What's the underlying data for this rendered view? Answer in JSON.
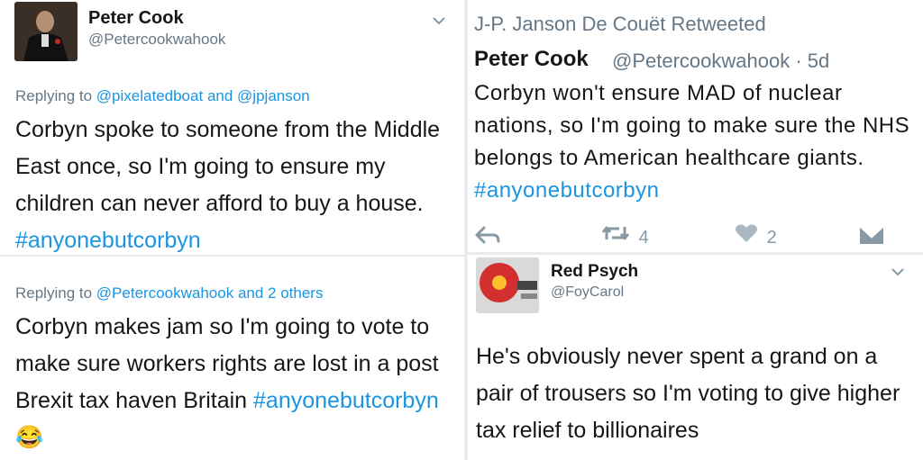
{
  "tweet_left_top": {
    "name": "Peter Cook",
    "handle": "@Petercookwahook",
    "replying_prefix": "Replying to",
    "mention_1": "@pixelatedboat",
    "conj": "and",
    "mention_2": "@jpjanson",
    "text": "Corbyn spoke to someone from the Middle East once, so I'm going to ensure my children can never afford to buy a house.",
    "hashtag": "#anyonebutcorbyn"
  },
  "tweet_left_bottom": {
    "replying_prefix": "Replying to",
    "mention_1": "@Petercookwahook",
    "others": "and 2 others",
    "text": "Corbyn makes jam so I'm going to vote to make sure workers rights are lost in a post Brexit tax haven Britain",
    "hashtag": "#anyonebutcorbyn",
    "emoji": "😂"
  },
  "tweet_right_top": {
    "retweeted_by": "J-P. Janson De Couët Retweeted",
    "name": "Peter Cook",
    "handle_time": "@Petercookwahook · 5d",
    "text": "Corbyn won't ensure MAD of nuclear nations, so I'm going to make sure the NHS belongs to American healthcare giants.",
    "hashtag": "#anyonebutcorbyn",
    "retweet_count": "4",
    "like_count": "2"
  },
  "tweet_right_bottom": {
    "name": "Red Psych",
    "handle": "@FoyCarol",
    "text": "He's obviously never spent a grand on a pair of trousers so I'm voting to give higher tax relief to billionaires"
  },
  "colors": {
    "link": "#1b95e0",
    "muted": "#657786",
    "icon": "#8899a6"
  }
}
